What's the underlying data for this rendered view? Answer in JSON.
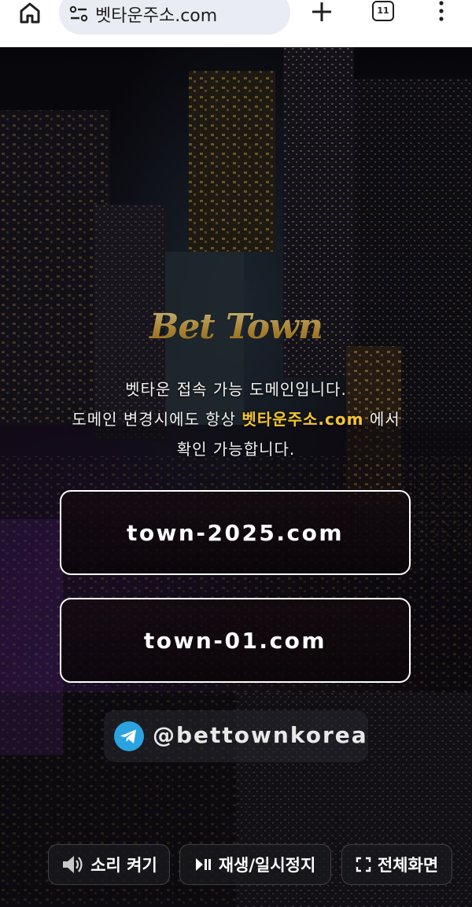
{
  "browser": {
    "url": "벳타운주소.com",
    "tab_count": "11"
  },
  "page": {
    "brand": "Bet Town",
    "info_line1": "벳타운 접속 가능 도메인입니다.",
    "info_line2_prefix": "도메인 변경시에도 항상 ",
    "info_line2_highlight": "벳타운주소.com",
    "info_line2_suffix": " 에서",
    "info_line3": "확인 가능합니다.",
    "domains": [
      "town-2025.com",
      "town-01.com"
    ],
    "telegram_handle": "@bettownkorea",
    "controls": {
      "sound": "소리 켜기",
      "play_pause": "재생/일시정지",
      "fullscreen": "전체화면"
    }
  },
  "colors": {
    "highlight": "#f4c430",
    "telegram": "#2aa3e0"
  }
}
